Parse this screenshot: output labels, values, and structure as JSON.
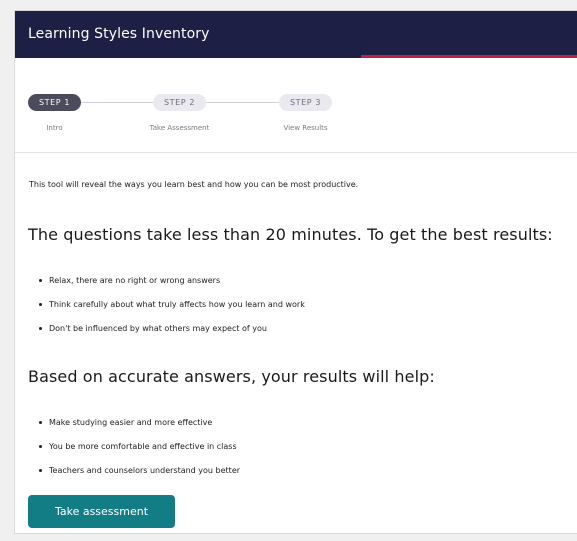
{
  "header": {
    "title": "Learning Styles Inventory"
  },
  "stepper": {
    "steps": [
      {
        "label": "STEP 1",
        "caption": "Intro"
      },
      {
        "label": "STEP 2",
        "caption": "Take Assessment"
      },
      {
        "label": "STEP 3",
        "caption": "View Results"
      }
    ],
    "active_index": 0
  },
  "content": {
    "intro": "This tool will reveal the ways you learn best and how you can be most productive.",
    "heading_1": "The questions take less than 20 minutes. To get the best results:",
    "bullets_1": [
      "Relax, there are no right or wrong answers",
      "Think carefully about what truly affects how you learn and work",
      "Don't be influenced by what others may expect of you"
    ],
    "heading_2": "Based on accurate answers, your results will help:",
    "bullets_2": [
      "Make studying easier and more effective",
      "You be more comfortable and effective in class",
      "Teachers and counselors understand you better"
    ]
  },
  "actions": {
    "take_assessment_label": "Take assessment"
  },
  "colors": {
    "header_bg": "#1e1f45",
    "header_accent": "#b5254a",
    "active_step": "#4b4b5d",
    "button": "#137d86"
  }
}
